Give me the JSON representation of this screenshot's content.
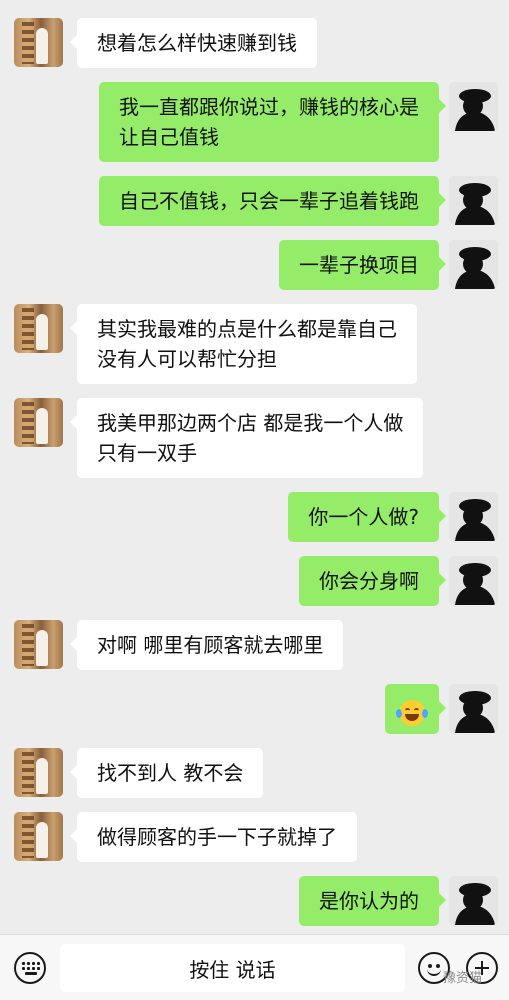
{
  "messages": [
    {
      "side": "them",
      "lines": [
        "想着怎么样快速赚到钱"
      ]
    },
    {
      "side": "me",
      "lines": [
        "我一直都跟你说过，赚钱的核心是",
        "让自己值钱"
      ]
    },
    {
      "side": "me",
      "lines": [
        "自己不值钱，只会一辈子追着钱跑"
      ]
    },
    {
      "side": "me",
      "lines": [
        "一辈子换项目"
      ]
    },
    {
      "side": "them",
      "lines": [
        "其实我最难的点是什么都是靠自己",
        "没有人可以帮忙分担"
      ]
    },
    {
      "side": "them",
      "lines": [
        "我美甲那边两个店 都是我一个人做",
        "只有一双手"
      ]
    },
    {
      "side": "me",
      "lines": [
        "你一个人做?"
      ]
    },
    {
      "side": "me",
      "lines": [
        "你会分身啊"
      ]
    },
    {
      "side": "them",
      "lines": [
        "对啊 哪里有顾客就去哪里"
      ]
    },
    {
      "side": "me",
      "emoji": "tears-of-joy-emoji"
    },
    {
      "side": "them",
      "lines": [
        "找不到人 教不会"
      ]
    },
    {
      "side": "them",
      "lines": [
        "做得顾客的手一下子就掉了"
      ]
    },
    {
      "side": "me",
      "lines": [
        "是你认为的"
      ]
    }
  ],
  "input_bar": {
    "voice_label": "按住 说话",
    "left_icon": "keyboard-icon",
    "right_icons": [
      "emoji-icon",
      "plus-icon"
    ]
  },
  "watermark": "豫资猫",
  "colors": {
    "background": "#ededed",
    "sent_bubble": "#95ec69",
    "received_bubble": "#ffffff"
  }
}
